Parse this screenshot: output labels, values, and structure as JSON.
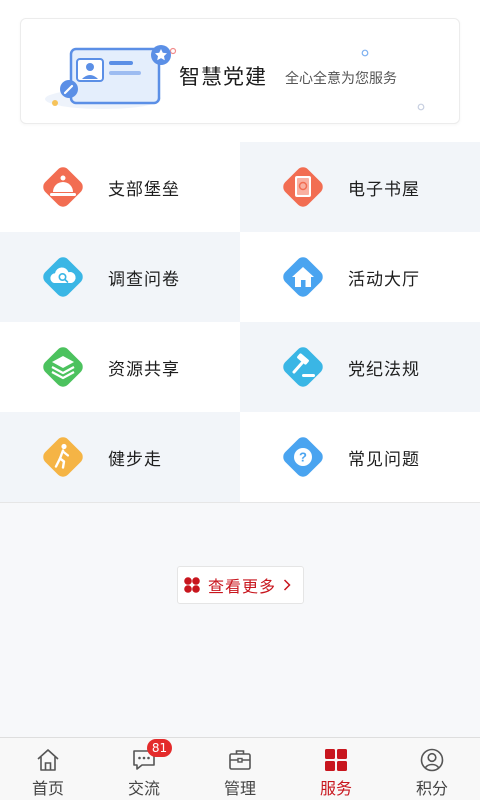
{
  "banner": {
    "title": "智慧党建",
    "subtitle": "全心全意为您服务"
  },
  "grid": [
    {
      "label": "支部堡垒",
      "icon": "dome-bell-icon",
      "color": "#f26d52"
    },
    {
      "label": "电子书屋",
      "icon": "e-book-icon",
      "color": "#f26d52"
    },
    {
      "label": "调查问卷",
      "icon": "cloud-search-icon",
      "color": "#3ab6e5"
    },
    {
      "label": "活动大厅",
      "icon": "house-icon",
      "color": "#4aa4f0"
    },
    {
      "label": "资源共享",
      "icon": "layers-icon",
      "color": "#4cc25e"
    },
    {
      "label": "党纪法规",
      "icon": "gavel-icon",
      "color": "#3ab6e5"
    },
    {
      "label": "健步走",
      "icon": "walking-icon",
      "color": "#f5b445"
    },
    {
      "label": "常见问题",
      "icon": "question-icon",
      "color": "#4aa4f0"
    }
  ],
  "more": {
    "label": "查看更多"
  },
  "tabs": [
    {
      "label": "首页",
      "icon": "home-icon"
    },
    {
      "label": "交流",
      "icon": "chat-icon",
      "badge": "81"
    },
    {
      "label": "管理",
      "icon": "briefcase-icon"
    },
    {
      "label": "服务",
      "icon": "grid-squares-icon",
      "active": true
    },
    {
      "label": "积分",
      "icon": "user-circle-icon"
    }
  ],
  "colors": {
    "accent": "#c8161e",
    "badge": "#e42b2b"
  }
}
